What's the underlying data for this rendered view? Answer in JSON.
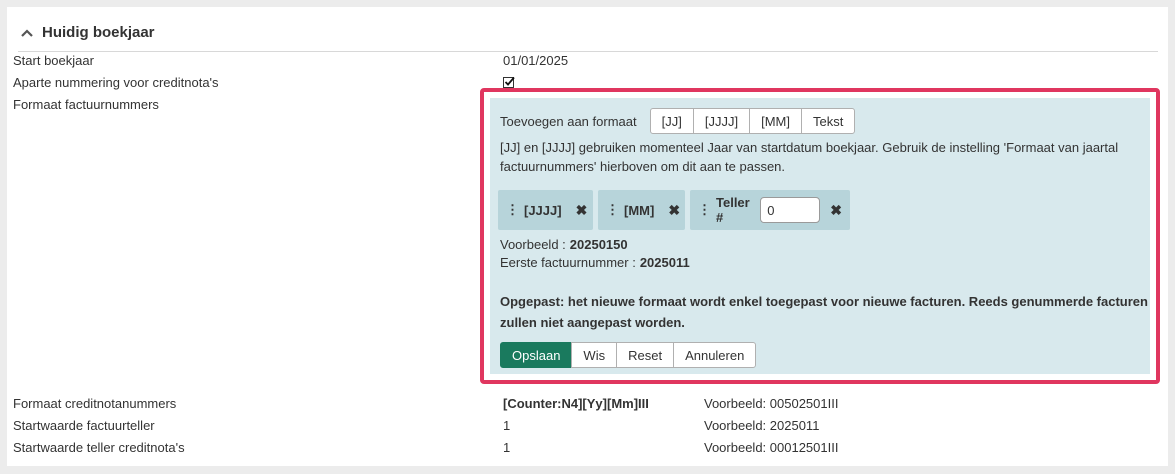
{
  "panel": {
    "title": "Huidig boekjaar"
  },
  "rows": {
    "start": {
      "label": "Start boekjaar",
      "value": "01/01/2025"
    },
    "credit_numbering": {
      "label": "Aparte nummering voor creditnota's",
      "checked": true
    },
    "invoice_format": {
      "label": "Formaat factuurnummers"
    },
    "credit_format": {
      "label": "Formaat creditnotanummers",
      "value": "[Counter:N4][Yy][Mm]III",
      "example": "Voorbeeld: 00502501III"
    },
    "invoice_counter": {
      "label": "Startwaarde factuurteller",
      "value": "1",
      "example": "Voorbeeld: 2025011"
    },
    "credit_counter": {
      "label": "Startwaarde teller creditnota's",
      "value": "1",
      "example": "Voorbeeld: 00012501III"
    }
  },
  "editor": {
    "add_label": "Toevoegen aan formaat",
    "add_buttons": [
      "[JJ]",
      "[JJJJ]",
      "[MM]",
      "Tekst"
    ],
    "info": "[JJ] en [JJJJ] gebruiken momenteel Jaar van startdatum boekjaar. Gebruik de instelling 'Formaat van jaartal factuurnummers' hierboven om dit aan te passen.",
    "tokens": [
      {
        "label": "[JJJJ]"
      },
      {
        "label": "[MM]"
      },
      {
        "label": "Teller #",
        "input_value": "0"
      }
    ],
    "example_label": "Voorbeeld :",
    "example_value": "20250150",
    "first_label": "Eerste factuurnummer :",
    "first_value": "2025011",
    "warning": "Opgepast: het nieuwe formaat wordt enkel toegepast voor nieuwe facturen. Reeds genummerde facturen zullen niet aangepast worden.",
    "actions": {
      "save": "Opslaan",
      "clear": "Wis",
      "reset": "Reset",
      "cancel": "Annuleren"
    }
  },
  "colors": {
    "highlight": "#e0365f",
    "editor_bg": "#d8e9ed",
    "token_bg": "#b7d4da",
    "primary": "#1a7a5e"
  },
  "icons": {
    "collapse": "chevron-up-icon",
    "remove": "close-icon",
    "drag": "drag-handle-icon",
    "checkbox": "checkbox-checked-icon"
  }
}
